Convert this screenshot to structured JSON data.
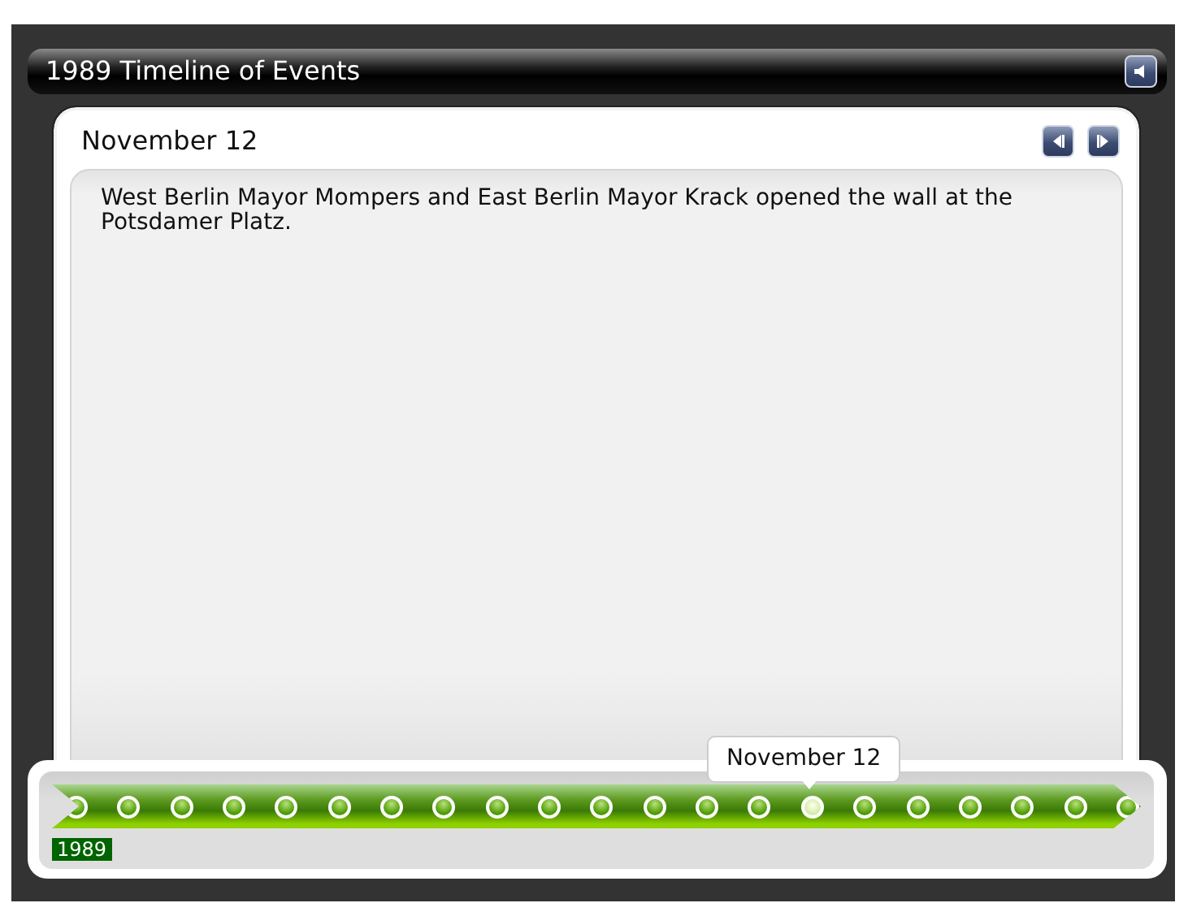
{
  "title": "1989 Timeline of Events",
  "event": {
    "date": "November 12",
    "text": "West Berlin Mayor Mompers and East Berlin Mayor Krack opened the wall at the Potsdamer Platz."
  },
  "timeline": {
    "year": "1989",
    "tooltip": "November 12",
    "points": [
      {
        "selected": false
      },
      {
        "selected": false
      },
      {
        "selected": false
      },
      {
        "selected": false
      },
      {
        "selected": false
      },
      {
        "selected": false
      },
      {
        "selected": false
      },
      {
        "selected": false
      },
      {
        "selected": false
      },
      {
        "selected": false
      },
      {
        "selected": false
      },
      {
        "selected": false
      },
      {
        "selected": false
      },
      {
        "selected": false
      },
      {
        "selected": true
      },
      {
        "selected": false
      },
      {
        "selected": false
      },
      {
        "selected": false
      },
      {
        "selected": false
      },
      {
        "selected": false
      },
      {
        "selected": false
      }
    ]
  }
}
